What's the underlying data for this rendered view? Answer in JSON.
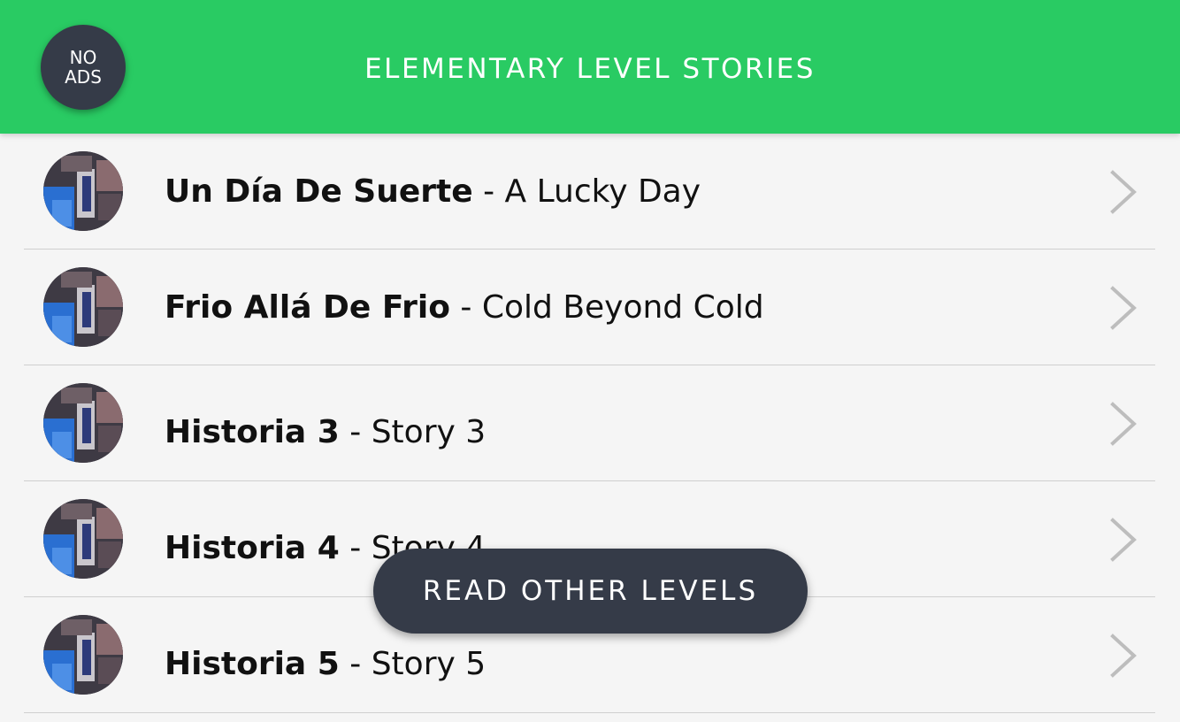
{
  "header": {
    "title": "ELEMENTARY LEVEL STORIES",
    "no_ads_line1": "NO",
    "no_ads_line2": "ADS",
    "background_color": "#29cb63"
  },
  "stories": [
    {
      "es": "Un Día De Suerte",
      "sep": " - ",
      "en": "A Lucky Day"
    },
    {
      "es": "Frio Allá De Frio",
      "sep": " - ",
      "en": "Cold Beyond Cold"
    },
    {
      "es": "Historia 3",
      "sep": " - ",
      "en": "Story 3"
    },
    {
      "es": "Historia 4",
      "sep": " - ",
      "en": "Story 4"
    },
    {
      "es": "Historia 5",
      "sep": " - ",
      "en": "Story 5"
    }
  ],
  "footer": {
    "read_other_label": "READ OTHER LEVELS",
    "button_color": "#353b48"
  },
  "icons": {
    "row_chevron": "chevron-right-icon",
    "row_thumbnail": "story-thumbnail"
  }
}
